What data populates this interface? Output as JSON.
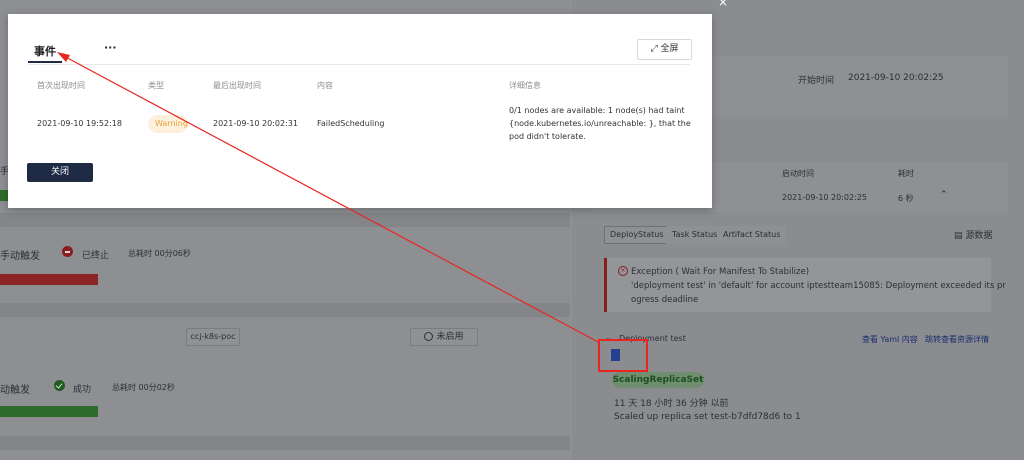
{
  "modal": {
    "tabs": [
      {
        "label": "事件"
      },
      {
        "label": "···"
      }
    ],
    "fullscreen_label": "全屏",
    "columns": [
      "首次出现时间",
      "类型",
      "最后出现时间",
      "内容",
      "详细信息"
    ],
    "rows": [
      {
        "first_time": "2021-09-10 19:52:18",
        "type": "Warning",
        "last_time": "2021-09-10 20:02:31",
        "content": "FailedScheduling",
        "detail_lines": [
          "0/1 nodes are available: 1 node(s) had taint",
          "{node.kubernetes.io/unreachable: }, that the",
          "pod didn't tolerate."
        ]
      }
    ],
    "close_label": "关闭"
  },
  "background": {
    "left": {
      "row_partial_label": "手云",
      "stage1": {
        "trigger": "手动触发",
        "status": "已终止",
        "duration": "总耗时 00分06秒",
        "status_color": "#8b1f1f"
      },
      "stage_tag": "ccj-k8s-poc",
      "disabled_label": "未启用",
      "stage2": {
        "trigger": "动触发",
        "status": "成功",
        "duration": "总耗时 00分02秒",
        "status_color": "#1f5c1f"
      }
    },
    "right": {
      "start_time_label": "开始时间",
      "start_time_value": "2021-09-10 20:02:25",
      "col_start": "启动时间",
      "col_duration": "耗时",
      "row_start": "2021-09-10 20:02:25",
      "row_duration": "6 秒",
      "tabs": [
        "DeployStatus",
        "Task Status",
        "Artifact Status"
      ],
      "source_label": "源数据",
      "error_lines": [
        "Exception ( Wait For Manifest To Stabilize)",
        "'deployment test' in 'default' for account iptestteam15085: Deployment exceeded its pr",
        "ogress deadline"
      ],
      "deploy_title": "Deployment test",
      "view_yaml": "查看 Yaml 内容",
      "jump_detail": "跳转查看资源详情",
      "event_tag": "ScalingReplicaSet",
      "event_time": "11 天 18 小时 36 分钟 以前",
      "event_msg": "Scaled up replica set test-b7dfd78d6 to 1"
    }
  },
  "colors": {
    "primary": "#1f2a45",
    "warning": "#e6a23c",
    "annotation": "#e8261f"
  }
}
